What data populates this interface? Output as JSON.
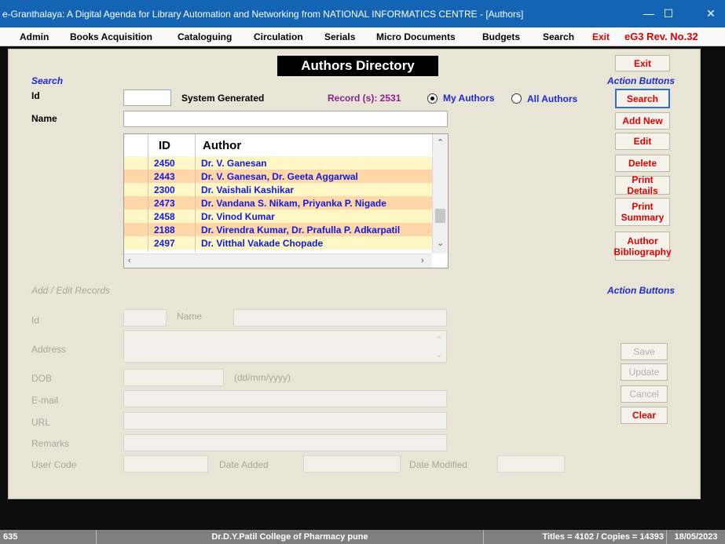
{
  "window": {
    "title": "e-Granthalaya: A Digital Agenda for Library Automation and Networking from NATIONAL INFORMATICS CENTRE - [Authors]",
    "minimize": "—",
    "maximize": "☐",
    "close": "✕"
  },
  "menu": {
    "items": [
      "Admin",
      "Books Acquisition",
      "Cataloguing",
      "Circulation",
      "Serials",
      "Micro Documents",
      "Budgets",
      "Search"
    ],
    "exit": "Exit",
    "version": "eG3 Rev. No.32"
  },
  "form": {
    "directory_title": "Authors Directory",
    "search_heading": "Search",
    "id_label": "Id",
    "id_value": "",
    "system_generated": "System Generated",
    "record_count": "Record (s): 2531",
    "radio_my_authors": "My Authors",
    "radio_all_authors": "All Authors",
    "selected_scope": "My Authors",
    "name_label": "Name",
    "name_value": ""
  },
  "grid": {
    "columns": [
      "ID",
      "Author"
    ],
    "rows": [
      {
        "id": "2450",
        "author": "Dr. V. Ganesan",
        "highlight": "yellow"
      },
      {
        "id": "2443",
        "author": "Dr. V. Ganesan, Dr. Geeta Aggarwal",
        "highlight": "orange"
      },
      {
        "id": "2300",
        "author": "Dr. Vaishali Kashikar",
        "highlight": "yellow"
      },
      {
        "id": "2473",
        "author": "Dr. Vandana S. Nikam, Priyanka P. Nigade",
        "highlight": "orange"
      },
      {
        "id": "2458",
        "author": "Dr. Vinod Kumar",
        "highlight": "yellow"
      },
      {
        "id": "2188",
        "author": "Dr. Virendra Kumar, Dr. Prafulla P. Adkarpatil",
        "highlight": "orange"
      },
      {
        "id": "2497",
        "author": "Dr. Vitthal Vakade Chopade",
        "highlight": "yellow"
      }
    ]
  },
  "actions_top": {
    "heading": "Action Buttons",
    "exit": "Exit",
    "search": "Search",
    "add_new": "Add New",
    "edit": "Edit",
    "delete": "Delete",
    "print_details": "Print Details",
    "print_summary": "Print Summary",
    "author_bibliography": "Author Bibliography"
  },
  "edit_section": {
    "heading": "Add / Edit Records",
    "id_label": "Id",
    "name_label": "Name",
    "address_label": "Address",
    "dob_label": "DOB",
    "dob_hint": "(dd/mm/yyyy)",
    "email_label": "E-mail",
    "url_label": "URL",
    "remarks_label": "Remarks",
    "user_code_label": "User Code",
    "date_added_label": "Date Added",
    "date_modified_label": "Date Modified"
  },
  "actions_bottom": {
    "heading": "Action Buttons",
    "save": "Save",
    "update": "Update",
    "cancel": "Cancel",
    "clear": "Clear"
  },
  "status": {
    "left": "635",
    "center": "Dr.D.Y.Patil College of Pharmacy pune",
    "counts": "Titles = 4102 / Copies = 14393",
    "date": "18/05/2023"
  },
  "colors": {
    "titlebar": "#1464b4",
    "accent_red": "#e00000",
    "accent_blue": "#1d2ad1",
    "row_yellow": "#fff6c6",
    "row_orange": "#ffd6a8"
  }
}
